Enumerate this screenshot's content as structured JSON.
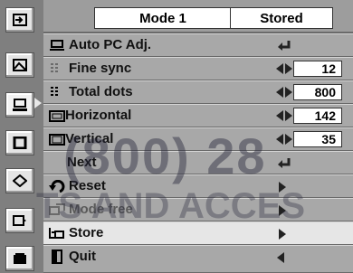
{
  "header": {
    "mode": "Mode 1",
    "status": "Stored"
  },
  "rail": {
    "icons": [
      "input-icon",
      "image-icon",
      "pc-adjust-icon",
      "screen-icon",
      "lamp-icon",
      "setting-icon",
      "info-icon"
    ]
  },
  "menu": [
    {
      "label": "Auto PC Adj.",
      "icon": "auto-pc-icon",
      "control": "enter"
    },
    {
      "label": "Fine sync",
      "icon": "fine-sync-icon",
      "control": "value",
      "value": "12"
    },
    {
      "label": "Total dots",
      "icon": "total-dots-icon",
      "control": "value",
      "value": "800"
    },
    {
      "label": "Horizontal",
      "icon": "horizontal-icon",
      "control": "value",
      "value": "142"
    },
    {
      "label": "Vertical",
      "icon": "vertical-icon",
      "control": "value",
      "value": "35"
    },
    {
      "label": "Next",
      "icon": "",
      "control": "enter"
    },
    {
      "label": "Reset",
      "icon": "reset-icon",
      "control": "arrow-right"
    },
    {
      "label": "Mode free",
      "icon": "mode-free-icon",
      "control": "arrow-right"
    },
    {
      "label": "Store",
      "icon": "store-icon",
      "control": "arrow-right"
    },
    {
      "label": "Quit",
      "icon": "quit-icon",
      "control": "arrow-left"
    }
  ],
  "watermark": {
    "line1": "(800) 28",
    "line2": "TS AND ACCES"
  }
}
